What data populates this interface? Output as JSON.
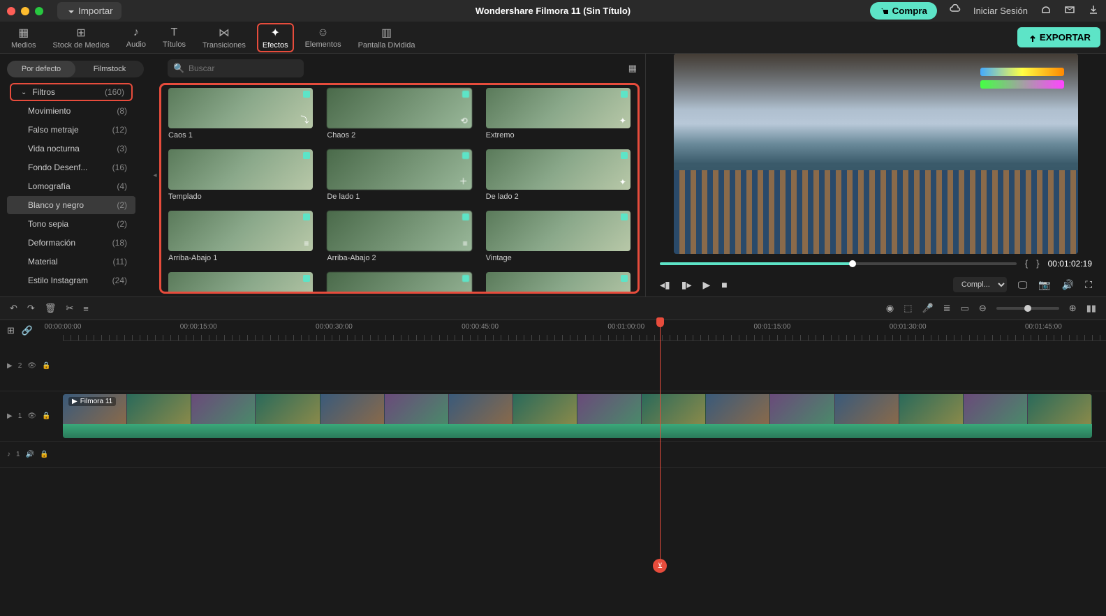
{
  "topbar": {
    "import_label": "Importar",
    "title": "Wondershare Filmora 11 (Sin Título)",
    "buy_label": "Compra",
    "login_label": "Iniciar Sesión"
  },
  "tabs": [
    {
      "label": "Medios",
      "active": false
    },
    {
      "label": "Stock de Medios",
      "active": false
    },
    {
      "label": "Audio",
      "active": false
    },
    {
      "label": "Títulos",
      "active": false
    },
    {
      "label": "Transiciones",
      "active": false
    },
    {
      "label": "Efectos",
      "active": true
    },
    {
      "label": "Elementos",
      "active": false
    },
    {
      "label": "Pantalla Dividida",
      "active": false
    }
  ],
  "export_label": "EXPORTAR",
  "sidebar": {
    "sub_tabs": {
      "default": "Por defecto",
      "filmstock": "Filmstock"
    },
    "categories": [
      {
        "name": "Filtros",
        "count": "(160)",
        "highlight": true,
        "chev": true
      },
      {
        "name": "Movimiento",
        "count": "(8)"
      },
      {
        "name": "Falso metraje",
        "count": "(12)"
      },
      {
        "name": "Vida nocturna",
        "count": "(3)"
      },
      {
        "name": "Fondo Desenf...",
        "count": "(16)"
      },
      {
        "name": "Lomografía",
        "count": "(4)"
      },
      {
        "name": "Blanco y negro",
        "count": "(2)",
        "active": true
      },
      {
        "name": "Tono sepia",
        "count": "(2)"
      },
      {
        "name": "Deformación",
        "count": "(18)"
      },
      {
        "name": "Material",
        "count": "(11)"
      },
      {
        "name": "Estilo Instagram",
        "count": "(24)"
      }
    ]
  },
  "search": {
    "placeholder": "Buscar"
  },
  "effects": [
    {
      "label": "Caos 1"
    },
    {
      "label": "Chaos 2"
    },
    {
      "label": "Extremo"
    },
    {
      "label": "Templado"
    },
    {
      "label": "De lado 1"
    },
    {
      "label": "De lado 2"
    },
    {
      "label": "Arriba-Abajo 1"
    },
    {
      "label": "Arriba-Abajo 2"
    },
    {
      "label": "Vintage"
    },
    {
      "label": ""
    },
    {
      "label": ""
    },
    {
      "label": ""
    }
  ],
  "preview": {
    "timecode": "00:01:02:19",
    "quality": "Compl..."
  },
  "ruler_marks": [
    {
      "t": "00:00:00:00",
      "pct": 0
    },
    {
      "t": "00:00:15:00",
      "pct": 13
    },
    {
      "t": "00:00:30:00",
      "pct": 26
    },
    {
      "t": "00:00:45:00",
      "pct": 40
    },
    {
      "t": "00:01:00:00",
      "pct": 54
    },
    {
      "t": "00:01:15:00",
      "pct": 68
    },
    {
      "t": "00:01:30:00",
      "pct": 81
    },
    {
      "t": "00:01:45:00",
      "pct": 94
    }
  ],
  "tracks": {
    "video2": "2",
    "video1": "1",
    "audio1": "1"
  },
  "clip_label": "Filmora 11"
}
